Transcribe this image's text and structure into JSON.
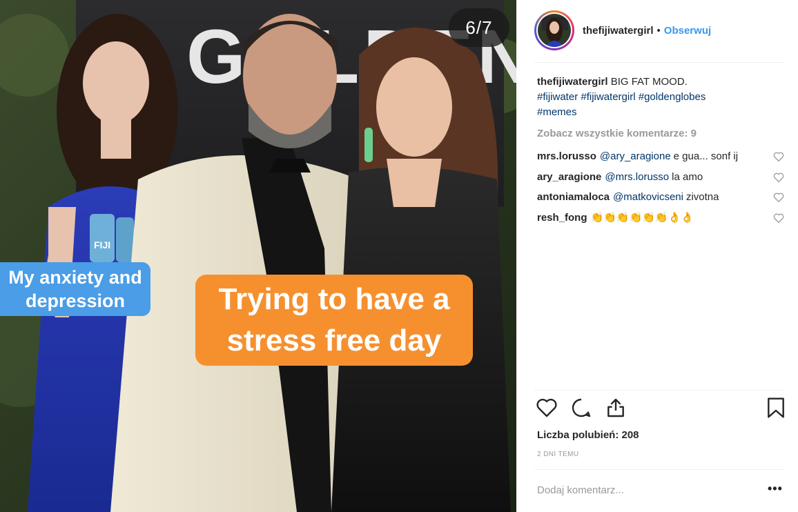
{
  "media": {
    "counter": "6/7",
    "backdrop_text": "GOLDEN GLOBES",
    "bottle_label": "FIJI",
    "caption_blue": "My anxiety and depression",
    "caption_orange": "Trying to have a stress free day",
    "colors": {
      "caption_blue": "#4a9de6",
      "caption_orange": "#f6902f"
    }
  },
  "header": {
    "username": "thefijiwatergirl",
    "separator": "•",
    "follow_label": "Obserwuj"
  },
  "caption": {
    "username": "thefijiwatergirl",
    "text": "BIG FAT MOOD.",
    "tags": [
      "#fijiwater",
      "#fijiwatergirl",
      "#goldenglobes",
      "#memes"
    ]
  },
  "view_all_comments": "Zobacz wszystkie komentarze: 9",
  "comments": [
    {
      "user": "mrs.lorusso",
      "mention": "@ary_aragione",
      "text": "e gua... sonf ij"
    },
    {
      "user": "ary_aragione",
      "mention": "@mrs.lorusso",
      "text": "la amo"
    },
    {
      "user": "antoniamaloca",
      "mention": "@matkovicseni",
      "text": "zivotna"
    },
    {
      "user": "resh_fong",
      "mention": "",
      "text": "👏👏👏👏👏👏👌👌"
    }
  ],
  "actions": {
    "like_icon": "heart-icon",
    "comment_icon": "comment-icon",
    "share_icon": "share-icon",
    "save_icon": "bookmark-icon"
  },
  "likes_text": "Liczba polubień: 208",
  "time_text": "2 DNI TEMU",
  "add_comment_placeholder": "Dodaj komentarz...",
  "more_label": "•••"
}
